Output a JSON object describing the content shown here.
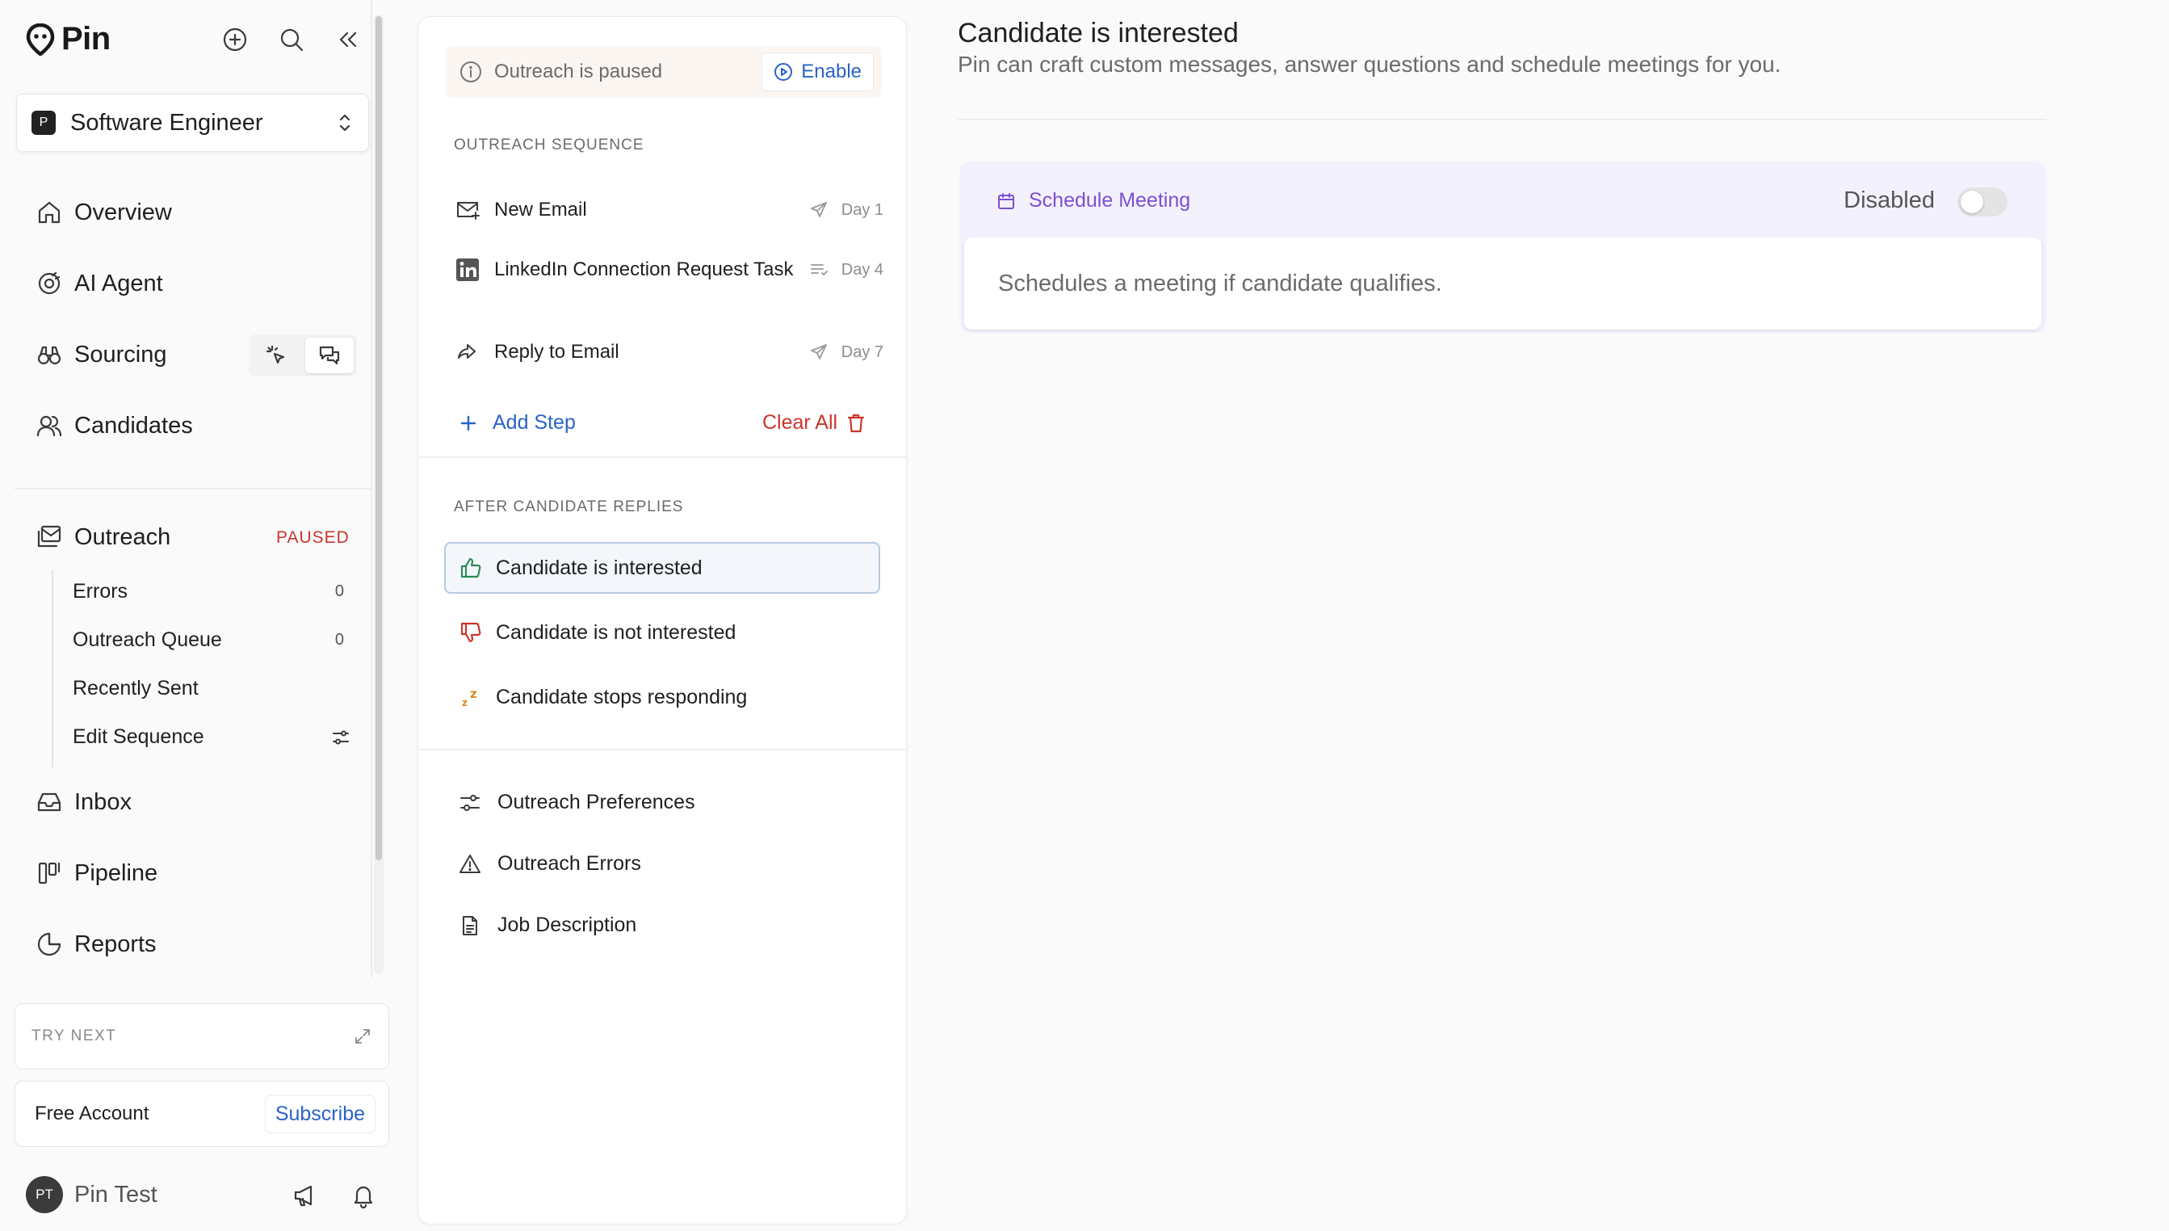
{
  "app": {
    "name": "Pin"
  },
  "job": {
    "badge": "P",
    "title": "Software Engineer"
  },
  "nav": {
    "overview": "Overview",
    "ai_agent": "AI Agent",
    "sourcing": "Sourcing",
    "candidates": "Candidates",
    "outreach": "Outreach",
    "outreach_badge": "PAUSED",
    "outreach_sub": [
      {
        "label": "Errors",
        "count": "0"
      },
      {
        "label": "Outreach Queue",
        "count": "0"
      },
      {
        "label": "Recently Sent",
        "count": ""
      },
      {
        "label": "Edit Sequence",
        "count": ""
      }
    ],
    "inbox": "Inbox",
    "pipeline": "Pipeline",
    "reports": "Reports"
  },
  "try_next": "TRY NEXT",
  "account": {
    "label": "Free Account",
    "subscribe": "Subscribe"
  },
  "user": {
    "initials": "PT",
    "name": "Pin Test"
  },
  "middle": {
    "paused_text": "Outreach is paused",
    "enable_label": "Enable",
    "sequence_heading": "OUTREACH SEQUENCE",
    "steps": [
      {
        "label": "New Email",
        "day": "Day 1"
      },
      {
        "label": "LinkedIn Connection Request Task",
        "day": "Day 4"
      },
      {
        "label": "Reply to Email",
        "day": "Day 7"
      }
    ],
    "add_step": "Add Step",
    "clear_all": "Clear All",
    "replies_heading": "AFTER CANDIDATE REPLIES",
    "replies": [
      "Candidate is interested",
      "Candidate is not interested",
      "Candidate stops responding"
    ],
    "bottom_links": [
      "Outreach Preferences",
      "Outreach Errors",
      "Job Description"
    ]
  },
  "detail": {
    "title": "Candidate is interested",
    "subtitle": "Pin can craft custom messages, answer questions and schedule meetings for you.",
    "card_title": "Schedule Meeting",
    "status": "Disabled",
    "enabled": false,
    "description": "Schedules a meeting if candidate qualifies."
  },
  "colors": {
    "accent_blue": "#2a63c7",
    "danger_red": "#c9362c",
    "purple": "#7c4fd1",
    "green": "#2e8b57"
  }
}
